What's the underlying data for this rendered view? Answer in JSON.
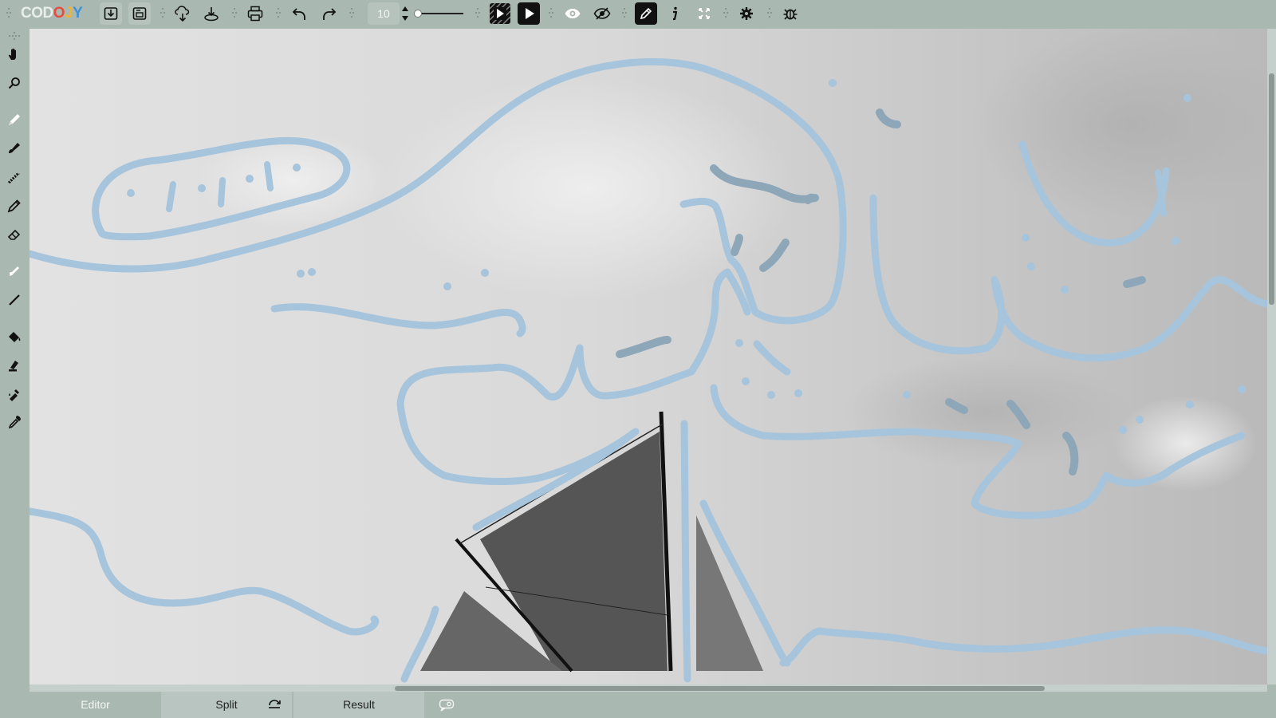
{
  "app": {
    "logo_letters": [
      "C",
      "O",
      "D",
      "O",
      "J",
      "Y"
    ],
    "logo_colors": [
      "#e8eeec",
      "#e8eeec",
      "#e8eeec",
      "#e94b3c",
      "#f2b233",
      "#3f8fd9"
    ],
    "accent_stroke_color": "#a6c4db",
    "toolbar_bg": "#a9b8b1"
  },
  "toolbar": {
    "zoom_value": "10",
    "brush_size_slider_level": 0.0,
    "icons": [
      "save-download-icon",
      "save-image-icon",
      "upload-cloud-icon",
      "import-icon",
      "print-icon",
      "undo-icon",
      "redo-icon",
      "animation-play-icon",
      "play-icon",
      "eye-icon",
      "hide-eye-icon",
      "pencil-mode-icon",
      "info-icon",
      "fullscreen-icon",
      "gear-icon",
      "bug-icon"
    ]
  },
  "left_tools": {
    "icons": [
      "move-hand-icon",
      "zoom-icon",
      "pen-tool-icon",
      "brush-tool-icon",
      "spray-tool-icon",
      "pencil-tool-icon",
      "eraser-tool-icon",
      "smudge-tool-icon",
      "line-tool-icon",
      "fill-bucket-icon",
      "stamp-icon",
      "color-replace-icon",
      "eyedropper-icon"
    ]
  },
  "bottom_tabs": {
    "editor": "Editor",
    "split": "Split",
    "result": "Result"
  }
}
